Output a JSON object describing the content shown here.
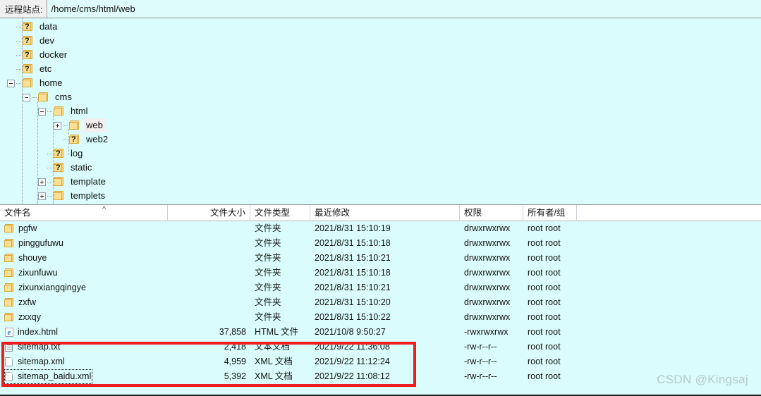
{
  "address": {
    "label": "远程站点:",
    "path": "/home/cms/html/web"
  },
  "tree": {
    "nodes": [
      {
        "label": "data",
        "depth": 1,
        "toggle": "none",
        "icon": "folder-question"
      },
      {
        "label": "dev",
        "depth": 1,
        "toggle": "none",
        "icon": "folder-question"
      },
      {
        "label": "docker",
        "depth": 1,
        "toggle": "none",
        "icon": "folder-question"
      },
      {
        "label": "etc",
        "depth": 1,
        "toggle": "none",
        "icon": "folder-question"
      },
      {
        "label": "home",
        "depth": 1,
        "toggle": "minus",
        "icon": "folder"
      },
      {
        "label": "cms",
        "depth": 2,
        "toggle": "minus",
        "icon": "folder"
      },
      {
        "label": "html",
        "depth": 3,
        "toggle": "minus",
        "icon": "folder"
      },
      {
        "label": "web",
        "depth": 4,
        "toggle": "plus",
        "icon": "folder",
        "selected": true
      },
      {
        "label": "web2",
        "depth": 4,
        "toggle": "none",
        "icon": "folder-question"
      },
      {
        "label": "log",
        "depth": 3,
        "toggle": "none",
        "icon": "folder-question"
      },
      {
        "label": "static",
        "depth": 3,
        "toggle": "none",
        "icon": "folder-question"
      },
      {
        "label": "template",
        "depth": 3,
        "toggle": "plus",
        "icon": "folder"
      },
      {
        "label": "templets",
        "depth": 3,
        "toggle": "plus",
        "icon": "folder"
      }
    ]
  },
  "filelist": {
    "columns": [
      {
        "key": "name",
        "label": "文件名",
        "align": "left"
      },
      {
        "key": "size",
        "label": "文件大小",
        "align": "right"
      },
      {
        "key": "type",
        "label": "文件类型",
        "align": "left"
      },
      {
        "key": "date",
        "label": "最近修改",
        "align": "left"
      },
      {
        "key": "perm",
        "label": "权限",
        "align": "left"
      },
      {
        "key": "owner",
        "label": "所有者/组",
        "align": "left"
      }
    ],
    "sort_indicator": "^",
    "rows": [
      {
        "name": "pgfw",
        "icon": "folder",
        "size": "",
        "type": "文件夹",
        "date": "2021/8/31 15:10:19",
        "perm": "drwxrwxrwx",
        "owner": "root root"
      },
      {
        "name": "pinggufuwu",
        "icon": "folder",
        "size": "",
        "type": "文件夹",
        "date": "2021/8/31 15:10:18",
        "perm": "drwxrwxrwx",
        "owner": "root root"
      },
      {
        "name": "shouye",
        "icon": "folder",
        "size": "",
        "type": "文件夹",
        "date": "2021/8/31 15:10:21",
        "perm": "drwxrwxrwx",
        "owner": "root root"
      },
      {
        "name": "zixunfuwu",
        "icon": "folder",
        "size": "",
        "type": "文件夹",
        "date": "2021/8/31 15:10:18",
        "perm": "drwxrwxrwx",
        "owner": "root root"
      },
      {
        "name": "zixunxiangqingye",
        "icon": "folder",
        "size": "",
        "type": "文件夹",
        "date": "2021/8/31 15:10:21",
        "perm": "drwxrwxrwx",
        "owner": "root root"
      },
      {
        "name": "zxfw",
        "icon": "folder",
        "size": "",
        "type": "文件夹",
        "date": "2021/8/31 15:10:20",
        "perm": "drwxrwxrwx",
        "owner": "root root"
      },
      {
        "name": "zxxqy",
        "icon": "folder",
        "size": "",
        "type": "文件夹",
        "date": "2021/8/31 15:10:22",
        "perm": "drwxrwxrwx",
        "owner": "root root"
      },
      {
        "name": "index.html",
        "icon": "html-file",
        "size": "37,858",
        "type": "HTML 文件",
        "date": "2021/10/8 9:50:27",
        "perm": "-rwxrwxrwx",
        "owner": "root root"
      },
      {
        "name": "sitemap.txt",
        "icon": "text-file",
        "size": "2,418",
        "type": "文本文档",
        "date": "2021/9/22 11:36:08",
        "perm": "-rw-r--r--",
        "owner": "root root"
      },
      {
        "name": "sitemap.xml",
        "icon": "xml-file",
        "size": "4,959",
        "type": "XML 文档",
        "date": "2021/9/22 11:12:24",
        "perm": "-rw-r--r--",
        "owner": "root root"
      },
      {
        "name": "sitemap_baidu.xml",
        "icon": "xml-file",
        "size": "5,392",
        "type": "XML 文档",
        "date": "2021/9/22 11:08:12",
        "perm": "-rw-r--r--",
        "owner": "root root",
        "focused": true
      }
    ]
  },
  "annotation": {
    "highlight_color": "#ee1c1c",
    "highlighted_rows": [
      "sitemap.txt",
      "sitemap.xml",
      "sitemap_baidu.xml"
    ]
  },
  "watermark": {
    "text": "CSDN @Kingsaj"
  }
}
